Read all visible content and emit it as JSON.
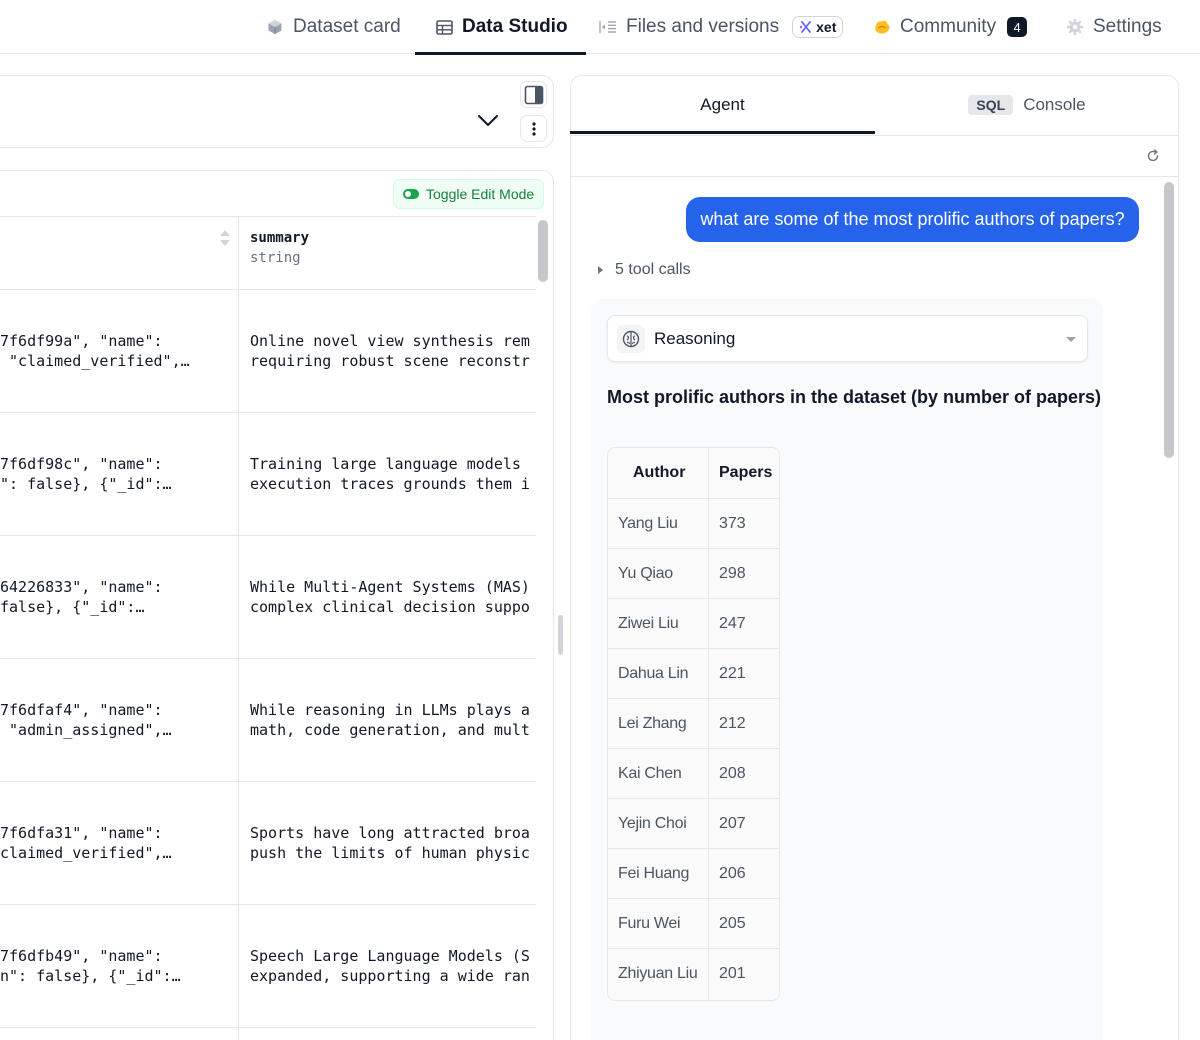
{
  "nav": {
    "tabs": [
      {
        "label": "Dataset card",
        "icon": "cube-icon"
      },
      {
        "label": "Data Studio",
        "icon": "table-icon",
        "active": true
      },
      {
        "label": "Files and versions",
        "icon": "files-icon",
        "badge": "xet"
      },
      {
        "label": "Community",
        "icon": "community-icon",
        "count": "4"
      },
      {
        "label": "Settings",
        "icon": "gear-icon"
      }
    ]
  },
  "data_table": {
    "toggle_edit_label": "Toggle Edit Mode",
    "column": {
      "name": "summary",
      "type": "string"
    },
    "rows": [
      {
        "c1a": "7f6df99a\", \"name\":",
        "c1b": " \"claimed_verified\",…",
        "c2a": "Online novel view synthesis rem",
        "c2b": "requiring robust scene reconstr"
      },
      {
        "c1a": "7f6df98c\", \"name\":",
        "c1b": "\": false}, {\"_id\":…",
        "c2a": "Training large language models ",
        "c2b": "execution traces grounds them i"
      },
      {
        "c1a": "64226833\", \"name\":",
        "c1b": "false}, {\"_id\":…",
        "c2a": "While Multi-Agent Systems (MAS)",
        "c2b": "complex clinical decision suppo"
      },
      {
        "c1a": "7f6dfaf4\", \"name\":",
        "c1b": " \"admin_assigned\",…",
        "c2a": "While reasoning in LLMs plays a",
        "c2b": "math, code generation, and mult"
      },
      {
        "c1a": "7f6dfa31\", \"name\":",
        "c1b": "claimed_verified\",…",
        "c2a": "Sports have long attracted broa",
        "c2b": "push the limits of human physic"
      },
      {
        "c1a": "7f6dfb49\", \"name\":",
        "c1b": "n\": false}, {\"_id\":…",
        "c2a": "Speech Large Language Models (S",
        "c2b": "expanded, supporting a wide ran"
      }
    ]
  },
  "agent": {
    "tabs": {
      "agent": "Agent",
      "sql_badge": "SQL",
      "console": "Console"
    },
    "user_message": "what are some of the most prolific authors of papers?",
    "tool_calls": "5 tool calls",
    "reasoning_label": "Reasoning",
    "answer_title": "Most prolific authors in the dataset (by number of papers)",
    "table": {
      "headers": {
        "author": "Author",
        "papers": "Papers"
      },
      "rows": [
        {
          "author": "Yang Liu",
          "papers": "373"
        },
        {
          "author": "Yu Qiao",
          "papers": "298"
        },
        {
          "author": "Ziwei Liu",
          "papers": "247"
        },
        {
          "author": "Dahua Lin",
          "papers": "221"
        },
        {
          "author": "Lei Zhang",
          "papers": "212"
        },
        {
          "author": "Kai Chen",
          "papers": "208"
        },
        {
          "author": "Yejin Choi",
          "papers": "207"
        },
        {
          "author": "Fei Huang",
          "papers": "206"
        },
        {
          "author": "Furu Wei",
          "papers": "205"
        },
        {
          "author": "Zhiyuan Liu",
          "papers": "201"
        }
      ]
    }
  },
  "colors": {
    "accent": "#2563eb",
    "edit_green": "#15803d",
    "ink": "#111827"
  }
}
